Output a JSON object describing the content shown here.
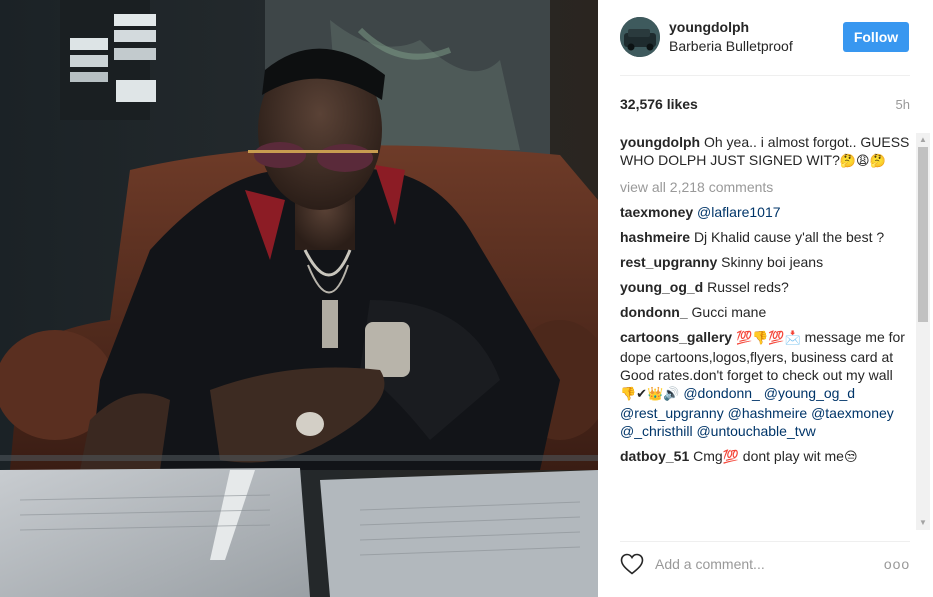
{
  "post": {
    "username": "youngdolph",
    "location": "Barberia Bulletproof",
    "follow_label": "Follow",
    "likes": "32,576 likes",
    "time": "5h",
    "caption": {
      "user": "youngdolph",
      "text": "Oh yea.. i almost forgot.. GUESS WHO DOLPH JUST SIGNED WIT?",
      "emojis": "🤔😩🤔"
    },
    "view_all": "view all 2,218 comments",
    "add_comment_placeholder": "Add a comment...",
    "more_label": "ooo"
  },
  "comments": [
    {
      "user": "taexmoney",
      "text": "",
      "mention": "@laflare1017"
    },
    {
      "user": "hashmeire",
      "text": "Dj Khalid cause y'all the best ?"
    },
    {
      "user": "rest_upgranny",
      "text": "Skinny boi jeans"
    },
    {
      "user": "young_og_d",
      "text": "Russel reds?"
    },
    {
      "user": "dondonn_",
      "text": "Gucci mane"
    },
    {
      "user": "cartoons_gallery",
      "emoji_a": "💯👎💯📩",
      "text": "message me for dope cartoons,logos,flyers, business card at Good rates.don't forget to check out my wall",
      "emoji_b": "👎✔👑🔊",
      "mentions": "@dondonn_ @young_og_d @rest_upgranny @hashmeire @taexmoney @_christhill @untouchable_tvw"
    },
    {
      "user": "datboy_51",
      "text": "Cmg",
      "emoji_a": "💯",
      "text2": "dont play wit me",
      "emoji_b": "😒"
    }
  ],
  "icons": {
    "heart": "heart-outline-icon",
    "scroll_up": "▲",
    "scroll_down": "▼"
  },
  "colors": {
    "follow_button": "#3897f0",
    "mention": "#003569",
    "muted": "#999999"
  }
}
